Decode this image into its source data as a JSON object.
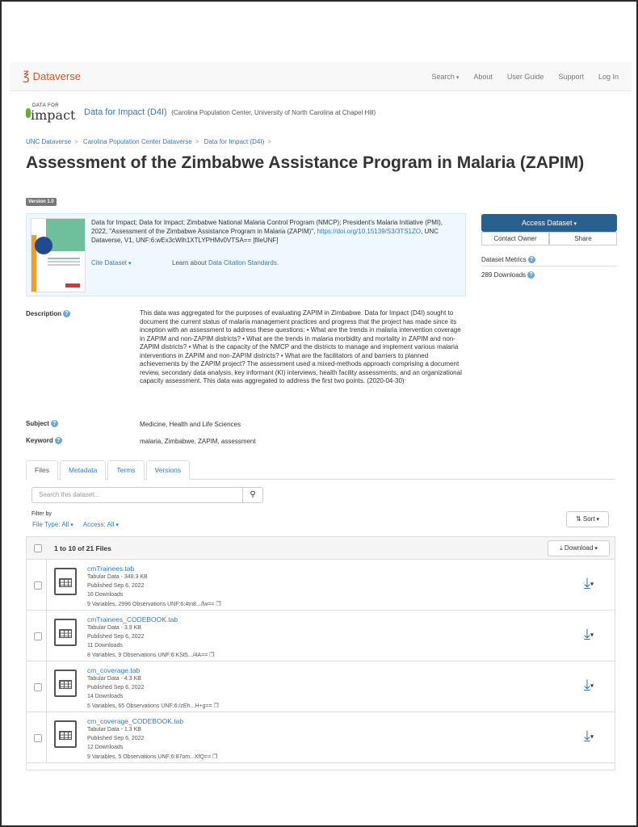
{
  "navbar": {
    "brand": "Dataverse",
    "links": [
      {
        "label": "Search",
        "dropdown": true
      },
      {
        "label": "About"
      },
      {
        "label": "User Guide"
      },
      {
        "label": "Support"
      },
      {
        "label": "Log In"
      }
    ]
  },
  "dataverse": {
    "logo_small": "DATA FOR",
    "logo_big": "impact",
    "name": "Data for Impact (D4I)",
    "affiliation": "(Carolina Population Center, University of North Carolina at Chapel Hill)"
  },
  "breadcrumb": [
    "UNC Dataverse",
    "Carolina Population Center Dataverse",
    "Data for Impact (D4I)"
  ],
  "dataset": {
    "title": "Assessment of the Zimbabwe Assistance Program in Malaria (ZAPIM)",
    "version": "Version 1.0",
    "citation_pre": "Data for Impact; Data for Impact; Zimbabwe National Malaria Control Program (NMCP); President's Malaria Initiative (PMI), 2022, \"Assessment of the Zimbabwe Assistance Program in Malaria (ZAPIM)\",",
    "citation_doi": "https://doi.org/10.15139/S3/3TS1ZO",
    "citation_post": ", UNC Dataverse, V1, UNF:6:wEx3cWlh1XTLYPHMv0VTSA== [fileUNF]",
    "cite_button": "Cite Dataset",
    "learn_text": "Learn about",
    "learn_link": "Data Citation Standards."
  },
  "actions": {
    "access": "Access Dataset",
    "contact": "Contact Owner",
    "share": "Share",
    "metrics_label": "Dataset Metrics",
    "downloads": "289 Downloads"
  },
  "metadata": {
    "description_label": "Description",
    "description": "This data was aggregated for the purposes of evaluating ZAPIM in Zimbabwe. Data for Impact (D4I) sought to document the current status of malaria management practices and progress that the project has made since its inception with an assessment to address these questions: • What are the trends in malaria intervention coverage in ZAPIM and non-ZAPIM districts? • What are the trends in malaria morbidity and mortality in ZAPIM and non-ZAPIM districts? • What is the capacity of the NMCP and the districts to manage and implement various malaria interventions in ZAPIM and non-ZAPIM districts? • What are the facilitators of and barriers to planned achievements by the ZAPIM project? The assessment used a mixed-methods approach comprising a document review, secondary data analysis, key informant (KI) interviews, health facility assessments, and an organizational capacity assessment. This data was aggregated to address the first two points. (2020-04-30)",
    "subject_label": "Subject",
    "subject": "Medicine, Health and Life Sciences",
    "keyword_label": "Keyword",
    "keyword": "malaria, Zimbabwe, ZAPIM, assessment"
  },
  "tabs": [
    "Files",
    "Metadata",
    "Terms",
    "Versions"
  ],
  "files": {
    "search_placeholder": "Search this dataset...",
    "filter_by": "Filter by",
    "file_type": "File Type: All",
    "access": "Access: All",
    "sort": "Sort",
    "count_text": "1 to 10 of 21 Files",
    "download": "Download",
    "rows": [
      {
        "name": "cmTrainees.tab",
        "type": "Tabular Data - 348.3 KB",
        "published": "Published Sep 6, 2022",
        "downloads": "16 Downloads",
        "vars": "9 Variables, 2996 Observations UNF:6:4tn8.../lw=="
      },
      {
        "name": "cmTrainees_CODEBOOK.tab",
        "type": "Tabular Data - 3.9 KB",
        "published": "Published Sep 6, 2022",
        "downloads": "11 Downloads",
        "vars": "8 Variables, 9 Observations UNF:6:KSt5.../4A=="
      },
      {
        "name": "cm_coverage.tab",
        "type": "Tabular Data - 4.3 KB",
        "published": "Published Sep 6, 2022",
        "downloads": "14 Downloads",
        "vars": "5 Variables, 65 Observations UNF:6:/zEh...H+g=="
      },
      {
        "name": "cm_coverage_CODEBOOK.tab",
        "type": "Tabular Data - 1.3 KB",
        "published": "Published Sep 6, 2022",
        "downloads": "12 Downloads",
        "vars": "9 Variables, 5 Observations UNF:6:87om...XfQ=="
      }
    ]
  }
}
